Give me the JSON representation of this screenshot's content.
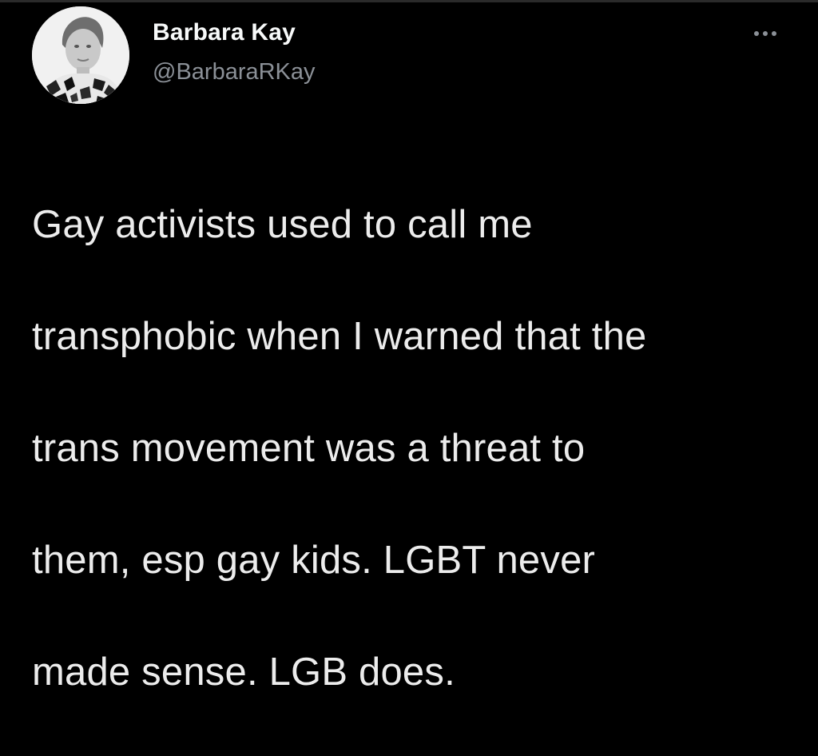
{
  "author": {
    "display_name": "Barbara Kay",
    "handle": "@BarbaraRKay",
    "avatar_icon": "profile-photo"
  },
  "tweet": {
    "text_lines": [
      "Gay activists used to call me",
      "transphobic when I warned that the",
      "trans movement was a threat to",
      "them, esp gay kids. LGBT never",
      "made sense. LGB does."
    ]
  },
  "menu": {
    "icon": "more-options-icon"
  },
  "colors": {
    "background": "#000000",
    "text": "#ececec",
    "secondary_text": "#8b9097"
  }
}
